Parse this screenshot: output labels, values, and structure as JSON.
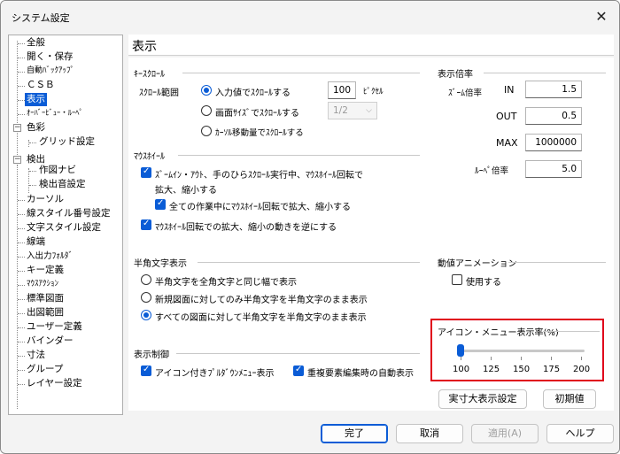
{
  "window": {
    "title": "システム設定",
    "close_glyph": "✕"
  },
  "tree": {
    "items": [
      {
        "label": "全般"
      },
      {
        "label": "開く・保存"
      },
      {
        "label": "自動ﾊﾞｯｸｱｯﾌﾟ"
      },
      {
        "label": "ＣＳＢ"
      },
      {
        "label": "表示"
      },
      {
        "label": "ｵｰﾊﾞｰﾋﾞｭｰ・ﾙｰﾍﾟ"
      },
      {
        "label": "色彩"
      },
      {
        "label": "グリッド設定"
      },
      {
        "label": "検出"
      },
      {
        "label": "作図ナビ"
      },
      {
        "label": "検出音設定"
      },
      {
        "label": "カーソル"
      },
      {
        "label": "線スタイル番号設定"
      },
      {
        "label": "文字スタイル設定"
      },
      {
        "label": "線端"
      },
      {
        "label": "入出力ﾌｫﾙﾀﾞ"
      },
      {
        "label": "キー定義"
      },
      {
        "label": "ﾏｳｽｱｸｼｮﾝ"
      },
      {
        "label": "標準図面"
      },
      {
        "label": "出図範囲"
      },
      {
        "label": "ユーザー定義"
      },
      {
        "label": "バインダー"
      },
      {
        "label": "寸法"
      },
      {
        "label": "グループ"
      },
      {
        "label": "レイヤー設定"
      }
    ],
    "expander_minus": "−"
  },
  "panel": {
    "title": "表示",
    "key_scroll": {
      "group": "ｷｰｽｸﾛｰﾙ",
      "range_label": "ｽｸﾛｰﾙ範囲",
      "opt_input": "入力値でｽｸﾛｰﾙする",
      "input_value": "100",
      "unit": "ﾋﾟｸｾﾙ",
      "opt_screen": "画面ｻｲｽﾞでｽｸﾛｰﾙする",
      "screen_value": "1/2",
      "opt_cursor": "ｶｰｿﾙ移動量でｽｸﾛｰﾙする"
    },
    "mouse_wheel": {
      "group": "ﾏｳｽﾎｲｰﾙ",
      "check1_line1": "ｽﾞｰﾑｲﾝ・ｱｳﾄ、手のひらｽｸﾛｰﾙ実行中、ﾏｳｽﾎｲｰﾙ回転で",
      "check1_line2": "拡大、縮小する",
      "check2": "全ての作業中にﾏｳｽﾎｲｰﾙ回転で拡大、縮小する",
      "check3": "ﾏｳｽﾎｲｰﾙ回転での拡大、縮小の動きを逆にする"
    },
    "zoom_ratio": {
      "group": "表示倍率",
      "zoom_label": "ｽﾞｰﾑ倍率",
      "in_label": "IN",
      "in_value": "1.5",
      "out_label": "OUT",
      "out_value": "0.5",
      "max_label": "MAX",
      "max_value": "1000000",
      "loupe_label": "ﾙｰﾍﾟ倍率",
      "loupe_value": "5.0"
    },
    "halfwidth": {
      "group": "半角文字表示",
      "opt1": "半角文字を全角文字と同じ幅で表示",
      "opt2": "新規図面に対してのみ半角文字を半角文字のまま表示",
      "opt3": "すべての図面に対して半角文字を半角文字のまま表示"
    },
    "smooth_anim": {
      "group": "動値アニメーション",
      "use": "使用する"
    },
    "icon_scale": {
      "group": "アイコン・メニュー表示率(%)",
      "ticks": [
        "100",
        "125",
        "150",
        "175",
        "200"
      ],
      "value": 100
    },
    "display_control": {
      "group": "表示制御",
      "check1": "アイコン付きﾌﾟﾙﾀﾞｳﾝﾒﾆｭｰ表示",
      "check2": "重複要素編集時の自動表示"
    },
    "actual_size_button": "実寸大表示設定",
    "reset_button": "初期値"
  },
  "footer": {
    "ok": "完了",
    "cancel": "取消",
    "apply": "適用(A)",
    "help": "ヘルプ"
  },
  "colors": {
    "accent": "#0a5cd6",
    "highlight_box": "#e0001b"
  }
}
